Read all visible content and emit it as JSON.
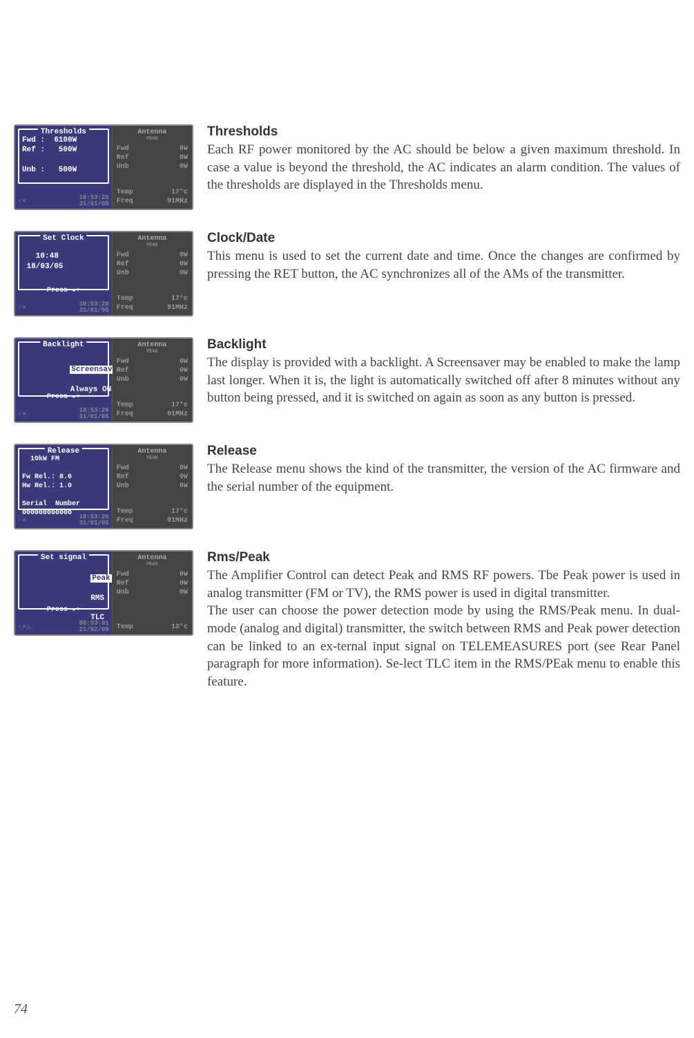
{
  "page_number": "74",
  "antenna_panel": {
    "header": "Antenna",
    "sub": "PEAK",
    "fwd_label": "Fwd",
    "fwd_val": "0W",
    "ref_label": "Ref",
    "ref_val": "0W",
    "unb_label": "Unb",
    "unb_val": "0W",
    "temp_label": "Temp",
    "temp_val": "17°c",
    "freq_label": "Freq",
    "freq_val": "91MHz"
  },
  "antenna_panel_sig": {
    "temp_val": "12°c"
  },
  "status": {
    "time": "18:53:26",
    "date": "31/01/05"
  },
  "status_sig": {
    "time": "08:53:01",
    "date": "21/02/08"
  },
  "screens": {
    "thresholds": {
      "title": "Thresholds",
      "body": "Fwd :  6100W\nRef :   500W\n\nUnb :   500W"
    },
    "clock": {
      "title": "Set Clock",
      "body": "\n   10:48\n 18/03/05",
      "press": "Press ▴▾"
    },
    "backlight": {
      "title": "Backlight",
      "line1": "Screensaver",
      "line2": "Always ON",
      "press": "Press ▴▾"
    },
    "release": {
      "title": "Release",
      "body": "  10kW FM\n\nFw Rel.: 8.6\nHw Rel.: 1.0\n\nSerial  Number\n000000000000"
    },
    "signal": {
      "title": "Set signal",
      "opt1": "Peak",
      "opt2": "RMS",
      "opt3": "TLC",
      "press": "Press ▴▾"
    }
  },
  "text": {
    "thresholds_h": "Thresholds",
    "thresholds_p": "Each  RF power monitored by the AC should be below a given maximum threshold. In case a value is beyond the threshold, the AC indicates an alarm condition. The values of the thresholds are displayed in the Thresholds menu.",
    "clock_h": "Clock/Date",
    "clock_p": "This menu is used to set the current date and time. Once the changes are confirmed by pressing the RET button, the AC synchronizes all of the AMs of the transmitter.",
    "backlight_h": "Backlight",
    "backlight_p": "The display is provided with a backlight. A Screensaver may be enabled to make the lamp last longer. When it is, the light is automatically switched off after 8 minutes without any button being pressed, and it is switched on again as soon as any button is pressed.",
    "release_h": "Release",
    "release_p": "The Release menu shows the kind of the transmitter, the version of the AC firmware and the serial number of the equipment.",
    "rms_h": "Rms/Peak",
    "rms_p1": "The Amplifier Control can detect Peak and RMS RF powers. Tbe Peak power is used in analog transmitter (FM or TV), the RMS power is used in digital transmitter.",
    "rms_p2": "The user can choose the power detection mode by using the RMS/Peak menu. In dual-mode (analog and digital) transmitter, the switch between RMS and Peak power detection can be linked to an ex-ternal input signal on TELEMEASURES port (see Rear Panel paragraph for more information). Se-lect TLC item in the RMS/PEak menu to enable this feature."
  }
}
